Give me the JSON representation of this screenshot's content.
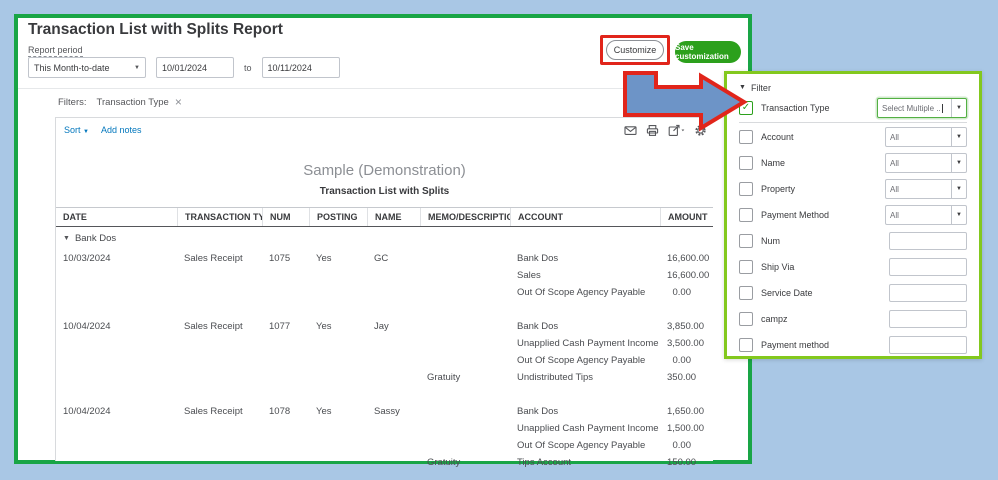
{
  "window": {
    "title": "Transaction List with Splits Report",
    "report_period_label": "Report period",
    "period_select": "This Month-to-date",
    "date_from": "10/01/2024",
    "date_to_label": "to",
    "date_to": "10/11/2024",
    "customize_button": "Customize",
    "save_button": "Save customization"
  },
  "filters_bar": {
    "label": "Filters:",
    "chip": "Transaction Type",
    "chip_close": "×"
  },
  "toolbar": {
    "sort_label": "Sort",
    "add_notes_label": "Add notes",
    "icons": [
      "email-icon",
      "print-icon",
      "export-icon",
      "settings-gear-icon"
    ]
  },
  "report": {
    "company": "Sample (Demonstration)",
    "title": "Transaction List with Splits",
    "columns": [
      "DATE",
      "TRANSACTION TYPE",
      "NUM",
      "POSTING",
      "NAME",
      "MEMO/DESCRIPTION",
      "ACCOUNT",
      "AMOUNT"
    ],
    "groups": [
      {
        "label": "Bank Dos",
        "transactions": [
          {
            "date": "10/03/2024",
            "type": "Sales Receipt",
            "num": "1075",
            "posting": "Yes",
            "name": "GC",
            "splits": [
              {
                "memo": "",
                "account": "Bank Dos",
                "amount": "16,600.00"
              },
              {
                "memo": "",
                "account": "Sales",
                "amount": "16,600.00"
              },
              {
                "memo": "",
                "account": "Out Of Scope Agency Payable",
                "amount": "0.00"
              }
            ]
          },
          {
            "date": "10/04/2024",
            "type": "Sales Receipt",
            "num": "1077",
            "posting": "Yes",
            "name": "Jay",
            "splits": [
              {
                "memo": "",
                "account": "Bank Dos",
                "amount": "3,850.00"
              },
              {
                "memo": "",
                "account": "Unapplied Cash Payment Income",
                "amount": "3,500.00"
              },
              {
                "memo": "",
                "account": "Out Of Scope Agency Payable",
                "amount": "0.00"
              },
              {
                "memo": "Gratuity",
                "account": "Undistributed Tips",
                "amount": "350.00"
              }
            ]
          },
          {
            "date": "10/04/2024",
            "type": "Sales Receipt",
            "num": "1078",
            "posting": "Yes",
            "name": "Sassy",
            "splits": [
              {
                "memo": "",
                "account": "Bank Dos",
                "amount": "1,650.00"
              },
              {
                "memo": "",
                "account": "Unapplied Cash Payment Income",
                "amount": "1,500.00"
              },
              {
                "memo": "",
                "account": "Out Of Scope Agency Payable",
                "amount": "0.00"
              },
              {
                "memo": "Gratuity",
                "account": "Tips Account",
                "amount": "150.00"
              }
            ]
          }
        ]
      }
    ]
  },
  "filter_panel": {
    "header": "Filter",
    "rows": [
      {
        "label": "Transaction Type",
        "checked": true,
        "control": "select",
        "value": "Select Multiple ..",
        "focused": true
      },
      {
        "label": "Account",
        "checked": false,
        "control": "select",
        "value": "All"
      },
      {
        "label": "Name",
        "checked": false,
        "control": "select",
        "value": "All"
      },
      {
        "label": "Property",
        "checked": false,
        "control": "select",
        "value": "All"
      },
      {
        "label": "Payment Method",
        "checked": false,
        "control": "select",
        "value": "All"
      },
      {
        "label": "Num",
        "checked": false,
        "control": "input",
        "value": ""
      },
      {
        "label": "Ship Via",
        "checked": false,
        "control": "input",
        "value": ""
      },
      {
        "label": "Service Date",
        "checked": false,
        "control": "input",
        "value": ""
      },
      {
        "label": "campz",
        "checked": false,
        "control": "input",
        "value": ""
      },
      {
        "label": "Payment method",
        "checked": false,
        "control": "input",
        "value": ""
      }
    ]
  },
  "colors": {
    "frame_green": "#19a546",
    "panel_lime": "#83c81e",
    "annotation_red": "#e1251b",
    "arrow_blue_fill": "#6d94c7",
    "save_button_green": "#2ca01c",
    "link_teal": "#0377bd",
    "background_blue": "#a9c7e5"
  }
}
